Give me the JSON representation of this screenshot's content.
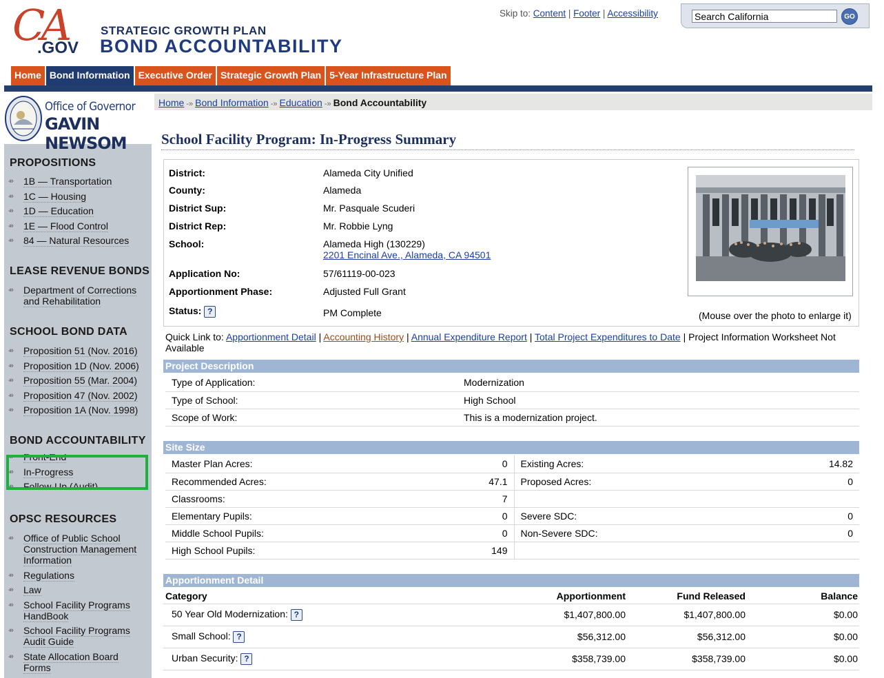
{
  "header": {
    "logo_top": "CA",
    "logo_bottom": ".GOV",
    "title_line1": "STRATEGIC GROWTH PLAN",
    "title_line2": "BOND ACCOUNTABILITY",
    "skip_to": "Skip to:",
    "skip_links": [
      "Content",
      "Footer",
      "Accessibility"
    ],
    "search_placeholder": "Search California",
    "search_go": "GO"
  },
  "topnav": [
    "Home",
    "Bond Information",
    "Executive Order",
    "Strategic Growth Plan",
    "5-Year Infrastructure Plan"
  ],
  "sidebar": {
    "office_of": "Office of Governor",
    "governor": "GAVIN NEWSOM",
    "propositions_title": "PROPOSITIONS",
    "propositions": [
      "1B — Transportation",
      "1C — Housing",
      "1D — Education",
      "1E — Flood Control",
      "84 — Natural Resources"
    ],
    "lease_title": "LEASE REVENUE BONDS",
    "lease": [
      "Department of Corrections and Rehabilitation"
    ],
    "school_title": "SCHOOL BOND DATA",
    "school": [
      "Proposition 51 (Nov. 2016)",
      "Proposition 1D (Nov. 2006)",
      "Proposition 55 (Mar. 2004)",
      "Proposition 47 (Nov. 2002)",
      "Proposition 1A (Nov. 1998)"
    ],
    "bond_title": "BOND ACCOUNTABILITY",
    "bond": [
      "Front-End",
      "In-Progress",
      "Follow-Up (Audit)"
    ],
    "opsc_title": "OPSC RESOURCES",
    "opsc": [
      "Office of Public School Construction Management Information",
      "Regulations",
      "Law",
      "School Facility Programs HandBook",
      "School Facility Programs Audit Guide",
      "State Allocation Board Forms"
    ],
    "highlight_color": "#1eb03e"
  },
  "breadcrumb": {
    "links": [
      "Home",
      "Bond Information",
      "Education"
    ],
    "current": "Bond Accountability"
  },
  "page_title": "School Facility Program: In-Progress Summary",
  "summary": {
    "district_label": "District:",
    "district": "Alameda City Unified",
    "county_label": "County:",
    "county": "Alameda",
    "sup_label": "District Sup:",
    "sup": "Mr. Pasquale Scuderi",
    "rep_label": "District Rep:",
    "rep": "Mr. Robbie Lyng",
    "school_label": "School:",
    "school": "Alameda High (130229)",
    "address": "2201 Encinal Ave., Alameda, CA 94501",
    "app_no_label": "Application No:",
    "app_no": "57/61119-00-023",
    "phase_label": "Apportionment Phase:",
    "phase": "Adjusted Full Grant",
    "status_label": "Status:",
    "status": "PM Complete",
    "photo_caption": "(Mouse over the photo to enlarge it)"
  },
  "quick_links": {
    "prefix": "Quick Link to:",
    "links": [
      "Apportionment Detail",
      "Accounting History",
      "Annual Expenditure Report",
      "Total Project Expenditures to Date"
    ],
    "suffix": "Project Information Worksheet Not Available"
  },
  "project_description": {
    "title": "Project Description",
    "rows": [
      {
        "label": "Type of Application:",
        "value": "Modernization"
      },
      {
        "label": "Type of School:",
        "value": "High School"
      },
      {
        "label": "Scope of Work:",
        "value": "This is a modernization project."
      }
    ]
  },
  "site_size": {
    "title": "Site Size",
    "rows": [
      {
        "l_label": "Master Plan Acres:",
        "l_val": "0",
        "r_label": "Existing Acres:",
        "r_val": "14.82"
      },
      {
        "l_label": "Recommended Acres:",
        "l_val": "47.1",
        "r_label": "Proposed Acres:",
        "r_val": "0"
      },
      {
        "l_label": "Classrooms:",
        "l_val": "7",
        "r_label": "",
        "r_val": ""
      },
      {
        "l_label": "Elementary Pupils:",
        "l_val": "0",
        "r_label": "Severe SDC:",
        "r_val": "0"
      },
      {
        "l_label": "Middle School Pupils:",
        "l_val": "0",
        "r_label": "Non-Severe SDC:",
        "r_val": "0"
      },
      {
        "l_label": "High School Pupils:",
        "l_val": "149",
        "r_label": "",
        "r_val": ""
      }
    ]
  },
  "apportionment": {
    "title": "Apportionment Detail",
    "headers": [
      "Category",
      "Apportionment",
      "Fund Released",
      "Balance"
    ],
    "rows": [
      {
        "category": "50 Year Old Modernization:",
        "apportionment": "$1,407,800.00",
        "released": "$1,407,800.00",
        "balance": "$0.00"
      },
      {
        "category": "Small School:",
        "apportionment": "$56,312.00",
        "released": "$56,312.00",
        "balance": "$0.00"
      },
      {
        "category": "Urban Security:",
        "apportionment": "$358,739.00",
        "released": "$358,739.00",
        "balance": "$0.00"
      }
    ]
  }
}
